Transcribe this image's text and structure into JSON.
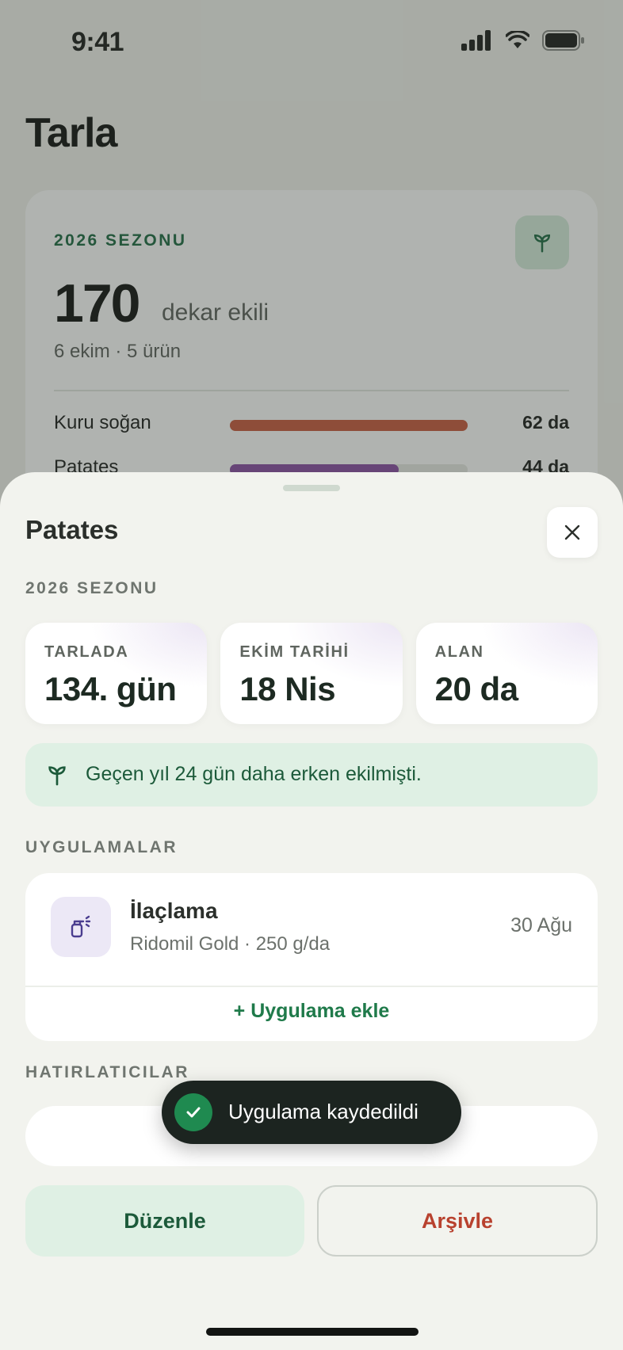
{
  "status_bar": {
    "time": "9:41"
  },
  "background": {
    "page_title": "Tarla",
    "summary": {
      "season_label": "2026 SEZONU",
      "total_area": "170",
      "total_area_unit": "dekar ekili",
      "sub_stats": "6 ekim · 5 ürün",
      "crops": [
        {
          "name": "Kuru soğan",
          "value": "62 da",
          "fill_fraction": 1.0,
          "color": "#c95b3f"
        },
        {
          "name": "Patates",
          "value": "44 da",
          "fill_fraction": 0.71,
          "color": "#8a4ea3"
        }
      ]
    }
  },
  "sheet": {
    "title": "Patates",
    "season_label": "2026 SEZONU",
    "stats": [
      {
        "label": "TARLADA",
        "value": "134. gün"
      },
      {
        "label": "EKİM TARİHİ",
        "value": "18 Nis"
      },
      {
        "label": "ALAN",
        "value": "20 da"
      }
    ],
    "info_banner": "Geçen yıl 24 gün daha erken ekilmişti.",
    "applications_label": "UYGULAMALAR",
    "applications": [
      {
        "title": "İlaçlama",
        "subtitle": "Ridomil Gold · 250 g/da",
        "date": "30 Ağu",
        "icon": "sprayer-icon"
      }
    ],
    "add_application": "+ Uygulama ekle",
    "reminders_label": "HATIRLATICILAR",
    "edit_button": "Düzenle",
    "archive_button": "Arşivle"
  },
  "toast": {
    "text": "Uygulama kaydedildi"
  },
  "colors": {
    "accent": "#1f7a4a",
    "danger": "#b8412e",
    "toast_bg": "#1c2420"
  }
}
